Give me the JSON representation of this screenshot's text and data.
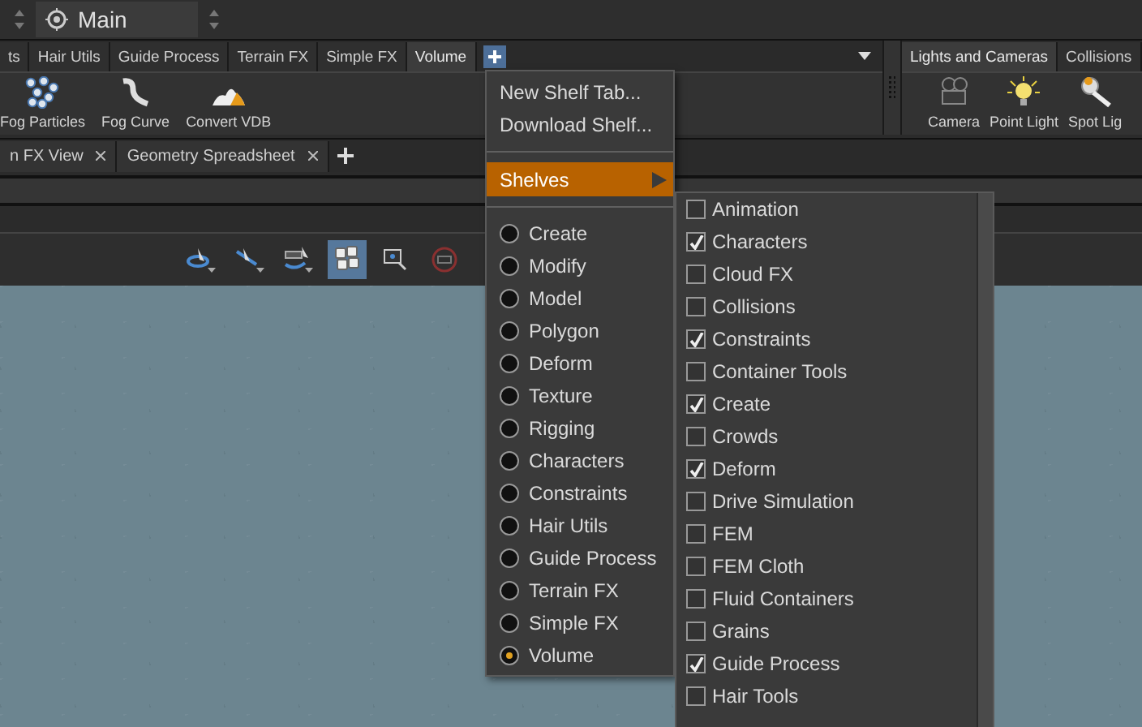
{
  "desktop": {
    "title": "Main"
  },
  "shelf_tabs": [
    {
      "label": "ts",
      "selected": false
    },
    {
      "label": "Hair Utils",
      "selected": false
    },
    {
      "label": "Guide Process",
      "selected": false
    },
    {
      "label": "Terrain FX",
      "selected": false
    },
    {
      "label": "Simple FX",
      "selected": false
    },
    {
      "label": "Volume",
      "selected": true
    }
  ],
  "shelf_tools": [
    {
      "label": "Fog Particles",
      "kind": "particles"
    },
    {
      "label": "Fog Curve",
      "kind": "curve"
    },
    {
      "label": "Convert VDB",
      "kind": "cloud"
    }
  ],
  "right_shelf_tabs": [
    {
      "label": "Lights and Cameras",
      "selected": true
    },
    {
      "label": "Collisions",
      "selected": false
    }
  ],
  "right_shelf_tools": [
    {
      "label": "Camera",
      "kind": "camera"
    },
    {
      "label": "Point Light",
      "kind": "bulb"
    },
    {
      "label": "Spot Lig",
      "kind": "spot"
    }
  ],
  "pane_tabs": [
    {
      "label": "n FX View"
    },
    {
      "label": "Geometry Spreadsheet"
    }
  ],
  "viewport_tools": [
    {
      "kind": "rotate",
      "active": false
    },
    {
      "kind": "select",
      "active": false
    },
    {
      "kind": "transform",
      "active": false
    },
    {
      "kind": "snap",
      "active": true
    },
    {
      "kind": "zoom",
      "active": false
    },
    {
      "kind": "stop",
      "active": false
    }
  ],
  "shelf_menu": {
    "actions": [
      "New Shelf Tab...",
      "Download Shelf..."
    ],
    "submenu_label": "Shelves",
    "shelf_sets": [
      {
        "label": "Create",
        "selected": false
      },
      {
        "label": "Modify",
        "selected": false
      },
      {
        "label": "Model",
        "selected": false
      },
      {
        "label": "Polygon",
        "selected": false
      },
      {
        "label": "Deform",
        "selected": false
      },
      {
        "label": "Texture",
        "selected": false
      },
      {
        "label": "Rigging",
        "selected": false
      },
      {
        "label": "Characters",
        "selected": false
      },
      {
        "label": "Constraints",
        "selected": false
      },
      {
        "label": "Hair Utils",
        "selected": false
      },
      {
        "label": "Guide Process",
        "selected": false
      },
      {
        "label": "Terrain FX",
        "selected": false
      },
      {
        "label": "Simple FX",
        "selected": false
      },
      {
        "label": "Volume",
        "selected": true
      }
    ]
  },
  "shelves_submenu": [
    {
      "label": "Animation",
      "checked": false
    },
    {
      "label": "Characters",
      "checked": true
    },
    {
      "label": "Cloud FX",
      "checked": false
    },
    {
      "label": "Collisions",
      "checked": false
    },
    {
      "label": "Constraints",
      "checked": true
    },
    {
      "label": "Container Tools",
      "checked": false
    },
    {
      "label": "Create",
      "checked": true
    },
    {
      "label": "Crowds",
      "checked": false
    },
    {
      "label": "Deform",
      "checked": true
    },
    {
      "label": "Drive Simulation",
      "checked": false
    },
    {
      "label": "FEM",
      "checked": false
    },
    {
      "label": "FEM Cloth",
      "checked": false
    },
    {
      "label": "Fluid Containers",
      "checked": false
    },
    {
      "label": "Grains",
      "checked": false
    },
    {
      "label": "Guide Process",
      "checked": true
    },
    {
      "label": "Hair Tools",
      "checked": false
    }
  ]
}
